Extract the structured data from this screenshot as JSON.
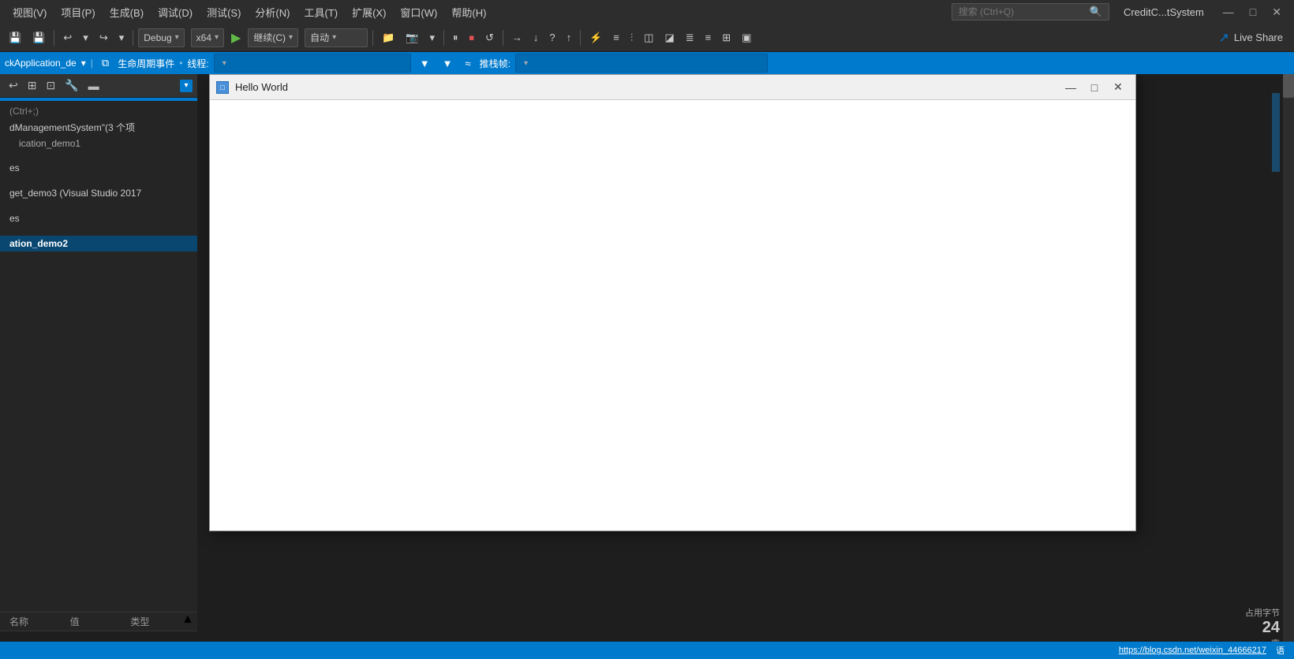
{
  "menubar": {
    "items": [
      {
        "label": "视图(V)"
      },
      {
        "label": "项目(P)"
      },
      {
        "label": "生成(B)"
      },
      {
        "label": "调试(D)"
      },
      {
        "label": "测试(S)"
      },
      {
        "label": "分析(N)"
      },
      {
        "label": "工具(T)"
      },
      {
        "label": "扩展(X)"
      },
      {
        "label": "窗口(W)"
      },
      {
        "label": "帮助(H)"
      }
    ],
    "search_placeholder": "搜索 (Ctrl+Q)",
    "title": "CreditC...tSystem",
    "minimize": "—",
    "maximize": "□",
    "close": "✕"
  },
  "toolbar": {
    "debug_mode": "Debug",
    "debug_mode_arrow": "▾",
    "platform": "x64",
    "platform_arrow": "▾",
    "continue": "继续(C)",
    "continue_arrow": "▾",
    "auto": "自动",
    "auto_arrow": "▾",
    "live_share": "Live Share"
  },
  "debug_bar": {
    "project": "ckApplication_de",
    "events": "生命周期事件",
    "threads": "线程:",
    "thread_value": "",
    "filter": "推栈帧:"
  },
  "sidebar": {
    "shortcut": "(Ctrl+;)",
    "project_title": "dManagementSystem\"(3 个项",
    "project_sub": "ication_demo1",
    "item1": "es",
    "item2": "get_demo3 (Visual Studio 2017",
    "item3": "es",
    "item4": "ation_demo2"
  },
  "sidebar_toolbar": {
    "btn1": "↩",
    "btn2": "⊞",
    "btn3": "⊡",
    "btn4": "🔧",
    "btn5": "▬"
  },
  "bottom_table": {
    "col1": "名称",
    "col2": "值",
    "col3": "类型"
  },
  "right_panel": {
    "number": "24",
    "label1": "占用字节",
    "label2": "率"
  },
  "hw_window": {
    "title": "Hello World",
    "icon": "□",
    "minimize": "—",
    "maximize": "□",
    "close": "✕"
  },
  "status_bar": {
    "link": "https://blog.csdn.net/weixin_44666217",
    "lang": "语"
  }
}
